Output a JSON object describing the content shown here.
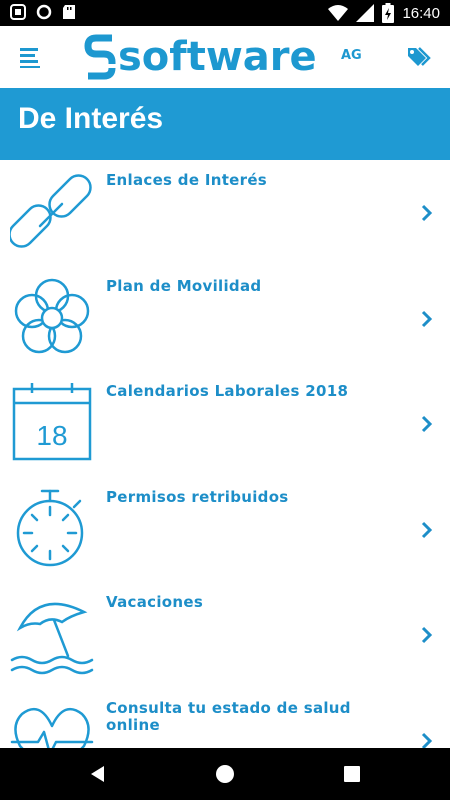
{
  "status_bar": {
    "time": "16:40"
  },
  "header": {
    "logo_text": "software",
    "logo_suffix": "AG"
  },
  "page_title": "De Interés",
  "items": [
    {
      "label": "Enlaces de Interés",
      "icon": "link-icon"
    },
    {
      "label": "Plan de Movilidad",
      "icon": "flower-icon"
    },
    {
      "label": "Calendarios Laborales 2018",
      "icon": "calendar-icon",
      "icon_text": "18"
    },
    {
      "label": "Permisos retribuidos",
      "icon": "stopwatch-icon"
    },
    {
      "label": "Vacaciones",
      "icon": "beach-umbrella-icon"
    },
    {
      "label": "Consulta tu estado de salud online",
      "icon": "heart-pulse-icon"
    }
  ],
  "colors": {
    "accent": "#1f9ad3",
    "text_accent": "#1d8ec8",
    "icon_stroke": "#1f9ad3"
  }
}
